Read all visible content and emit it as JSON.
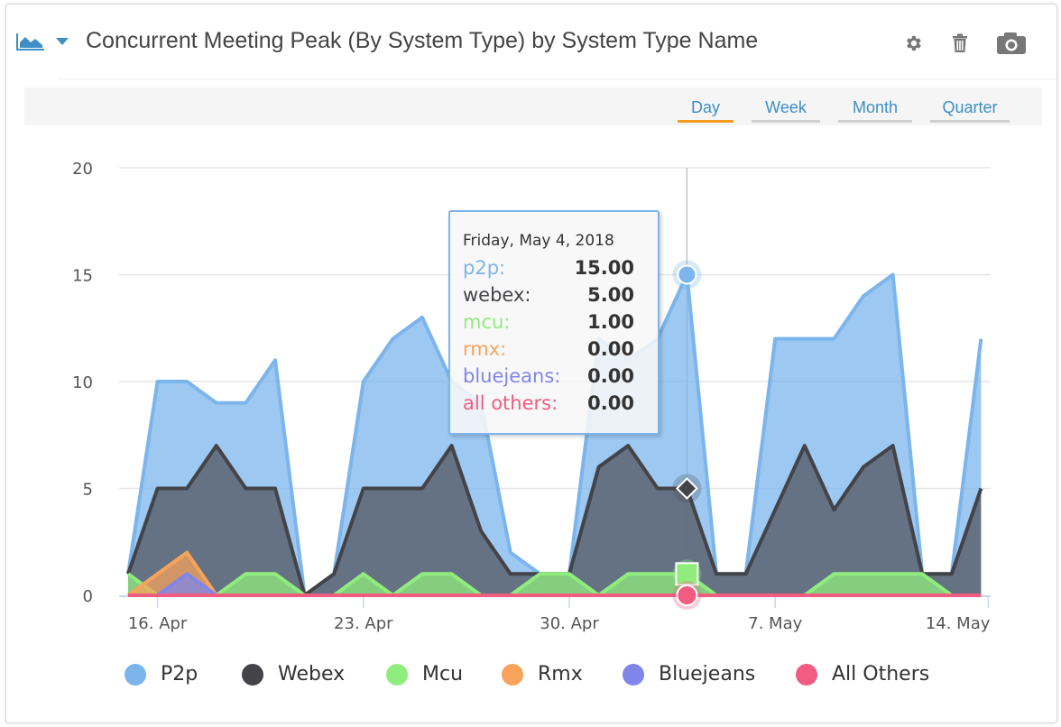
{
  "header": {
    "title": "Concurrent Meeting Peak (By System Type) by System Type Name",
    "chart_type_icon": "area-chart-icon",
    "dropdown_icon": "caret-down-icon",
    "actions": [
      {
        "name": "settings",
        "icon": "gear-icon"
      },
      {
        "name": "delete",
        "icon": "trash-icon"
      },
      {
        "name": "screenshot",
        "icon": "camera-icon"
      }
    ]
  },
  "range_selector": {
    "options": [
      "Day",
      "Week",
      "Month",
      "Quarter"
    ],
    "active": "Day"
  },
  "tooltip": {
    "date": "Friday, May 4, 2018",
    "rows": [
      {
        "label": "p2p:",
        "value": "15.00",
        "color": "#7cb5ec"
      },
      {
        "label": "webex:",
        "value": "5.00",
        "color": "#434348"
      },
      {
        "label": "mcu:",
        "value": "1.00",
        "color": "#90ed7d"
      },
      {
        "label": "rmx:",
        "value": "0.00",
        "color": "#f7a35c"
      },
      {
        "label": "bluejeans:",
        "value": "0.00",
        "color": "#8085e9"
      },
      {
        "label": "all others:",
        "value": "0.00",
        "color": "#f15c80"
      }
    ]
  },
  "chart_data": {
    "type": "area",
    "title": "Concurrent Meeting Peak (By System Type) by System Type Name",
    "xlabel": "",
    "ylabel": "",
    "ylim": [
      0,
      20
    ],
    "yticks": [
      0,
      5,
      10,
      15,
      20
    ],
    "xticks": [
      "16. Apr",
      "23. Apr",
      "30. Apr",
      "7. May",
      "14. May"
    ],
    "grid": true,
    "legend_position": "bottom",
    "x": [
      "2018-04-15",
      "2018-04-16",
      "2018-04-17",
      "2018-04-18",
      "2018-04-19",
      "2018-04-20",
      "2018-04-21",
      "2018-04-22",
      "2018-04-23",
      "2018-04-24",
      "2018-04-25",
      "2018-04-26",
      "2018-04-27",
      "2018-04-28",
      "2018-04-29",
      "2018-04-30",
      "2018-05-01",
      "2018-05-02",
      "2018-05-03",
      "2018-05-04",
      "2018-05-05",
      "2018-05-06",
      "2018-05-07",
      "2018-05-08",
      "2018-05-09",
      "2018-05-10",
      "2018-05-11",
      "2018-05-12",
      "2018-05-13",
      "2018-05-14"
    ],
    "series": [
      {
        "name": "P2p",
        "color": "#7cb5ec",
        "values": [
          1,
          10,
          10,
          9,
          9,
          11,
          0,
          1,
          10,
          12,
          13,
          10,
          9,
          2,
          1,
          1,
          12,
          11,
          12,
          15,
          1,
          1,
          12,
          12,
          12,
          14,
          15,
          1,
          1,
          12
        ]
      },
      {
        "name": "Webex",
        "color": "#434348",
        "values": [
          1,
          5,
          5,
          7,
          5,
          5,
          0,
          1,
          5,
          5,
          5,
          7,
          3,
          1,
          1,
          1,
          6,
          7,
          5,
          5,
          1,
          1,
          4,
          7,
          4,
          6,
          7,
          1,
          1,
          5
        ]
      },
      {
        "name": "Mcu",
        "color": "#90ed7d",
        "values": [
          1,
          0,
          0,
          0,
          1,
          1,
          0,
          0,
          1,
          0,
          1,
          1,
          0,
          0,
          1,
          1,
          0,
          1,
          1,
          1,
          0,
          0,
          0,
          0,
          1,
          1,
          1,
          1,
          0,
          0
        ]
      },
      {
        "name": "Rmx",
        "color": "#f7a35c",
        "values": [
          0,
          1,
          2,
          0,
          0,
          0,
          0,
          0,
          0,
          0,
          0,
          0,
          0,
          0,
          0,
          0,
          0,
          0,
          0,
          0,
          0,
          0,
          0,
          0,
          0,
          0,
          0,
          0,
          0,
          0
        ]
      },
      {
        "name": "Bluejeans",
        "color": "#8085e9",
        "values": [
          0,
          0,
          1,
          0,
          0,
          0,
          0,
          0,
          0,
          0,
          0,
          0,
          0,
          0,
          0,
          0,
          0,
          0,
          0,
          0,
          0,
          0,
          0,
          0,
          0,
          0,
          0,
          0,
          0,
          0
        ]
      },
      {
        "name": "All Others",
        "color": "#f15c80",
        "values": [
          0,
          0,
          0,
          0,
          0,
          0,
          0,
          0,
          0,
          0,
          0,
          0,
          0,
          0,
          0,
          0,
          0,
          0,
          0,
          0,
          0,
          0,
          0,
          0,
          0,
          0,
          0,
          0,
          0,
          0
        ]
      }
    ],
    "highlighted_x": "2018-05-04"
  }
}
